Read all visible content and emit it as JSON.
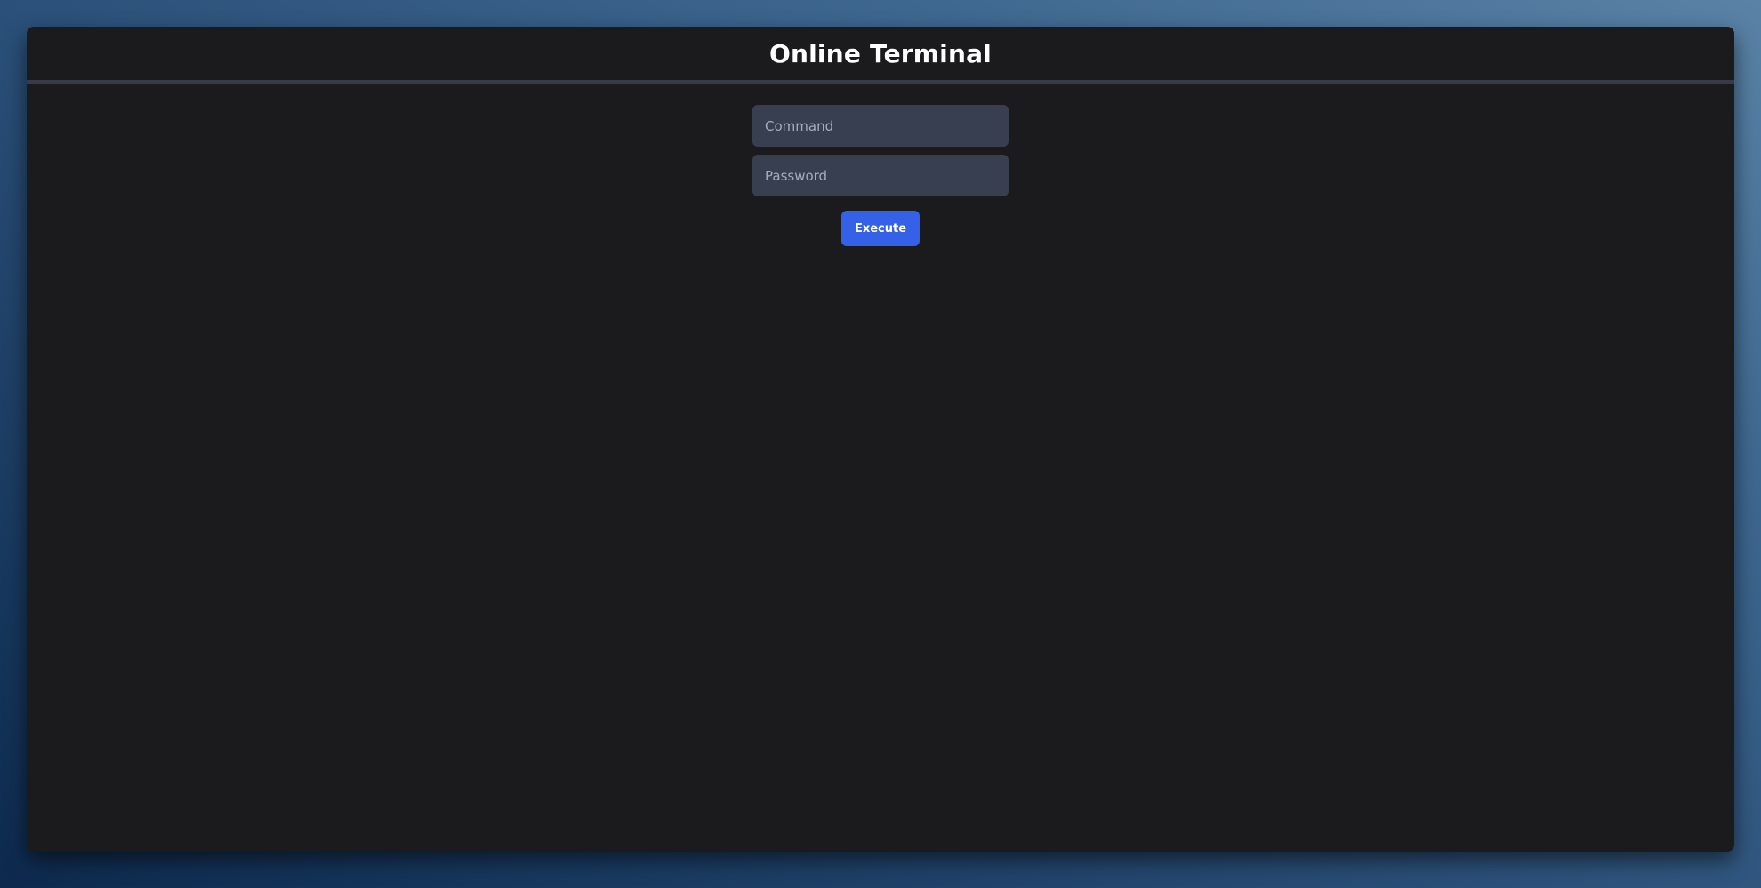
{
  "app": {
    "title": "Online Terminal"
  },
  "form": {
    "command": {
      "placeholder": "Command",
      "value": ""
    },
    "password": {
      "placeholder": "Password",
      "value": ""
    },
    "execute_label": "Execute"
  },
  "colors": {
    "panel_background": "#1b1a1d",
    "input_background": "#373f50",
    "accent": "#3461e8",
    "header_divider": "#373b48"
  }
}
